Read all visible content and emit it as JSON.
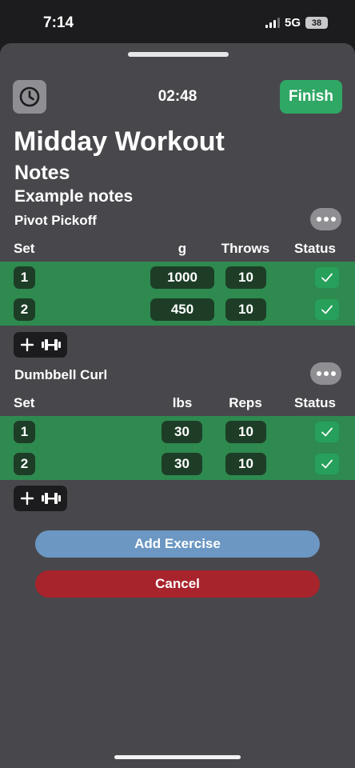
{
  "status_bar": {
    "time": "7:14",
    "network": "5G",
    "battery": "38"
  },
  "header": {
    "elapsed": "02:48",
    "finish_label": "Finish"
  },
  "workout": {
    "title": "Midday Workout",
    "notes_heading": "Notes",
    "notes_text": "Example notes"
  },
  "exercises": [
    {
      "name": "Pivot Pickoff",
      "columns": [
        "Set",
        "g",
        "Throws",
        "Status"
      ],
      "sets": [
        {
          "set": "1",
          "weight": "1000",
          "count": "10",
          "done": true
        },
        {
          "set": "2",
          "weight": "450",
          "count": "10",
          "done": true
        }
      ]
    },
    {
      "name": "Dumbbell Curl",
      "columns": [
        "Set",
        "lbs",
        "Reps",
        "Status"
      ],
      "sets": [
        {
          "set": "1",
          "weight": "30",
          "count": "10",
          "done": true
        },
        {
          "set": "2",
          "weight": "30",
          "count": "10",
          "done": true
        }
      ]
    }
  ],
  "actions": {
    "add_exercise": "Add Exercise",
    "cancel": "Cancel"
  },
  "icons": {
    "timer": "clock-icon",
    "more": "ellipsis-icon",
    "add": "plus-icon",
    "weight": "dumbbell-icon",
    "check": "checkmark-icon"
  },
  "colors": {
    "finish": "#2fa765",
    "completed_row": "#2e8a4f",
    "add_exercise": "#6b97c2",
    "cancel": "#a8242d"
  }
}
